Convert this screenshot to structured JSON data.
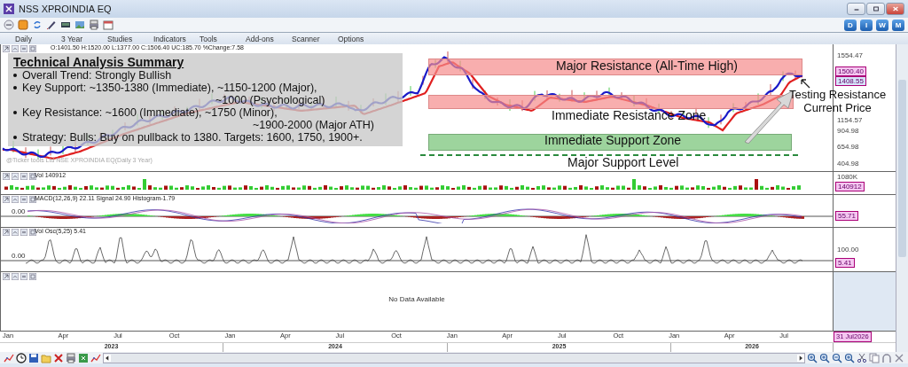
{
  "window": {
    "title": "NSS XPROINDIA EQ"
  },
  "period_buttons": [
    "D",
    "I",
    "W",
    "M"
  ],
  "menu": [
    "Daily",
    "3 Year",
    "Studies",
    "Indicators",
    "Tools",
    "Add-ons",
    "Scanner",
    "Options"
  ],
  "price_pane": {
    "ohlc": "O:1401.50  H:1520.00  L:1377.00  C:1506.40  UC:185.70  %Change:7.58",
    "watermark": "@Ticker tools Ltd NSE XPROINDIA EQ(Daily 3 Year)",
    "summary": {
      "title": "Technical Analysis Summary",
      "bullets": [
        {
          "text": "Overall Trend: Strongly Bullish"
        },
        {
          "text": "Key Support: ~1350-1380 (Immediate), ~1150-1200 (Major),",
          "continuation": "~1000 (Psychological)"
        },
        {
          "text": "Key Resistance:  ~1600 (Immediate), ~1750 (Minor),",
          "continuation": "~1900-2000 (Major ATH)"
        },
        {
          "text": "Strategy: Bulls: Buy on pullback to 1380. Targets: 1600, 1750, 1900+."
        }
      ]
    },
    "zones": [
      {
        "kind": "major_resistance",
        "label": "Major Resistance (All-Time High)"
      },
      {
        "kind": "immediate_resistance",
        "label": "Immediate Resistance Zone"
      },
      {
        "kind": "immediate_support",
        "label": "Immediate Support Zone"
      },
      {
        "kind": "major_support",
        "label": "Major Support Level"
      }
    ],
    "callout": [
      "Testing Resistance",
      "Current Price"
    ],
    "axis_ticks": [
      "1554.47",
      "1154.57",
      "904.98",
      "654.98",
      "404.98"
    ],
    "price_tags": [
      {
        "text": "1500.40",
        "color": "#f4c6f0"
      },
      {
        "text": "1408.55",
        "color": "#d6e4fa"
      }
    ]
  },
  "volume_pane": {
    "label": "Vol 140912",
    "axis_tick": "1080K",
    "value_tag": "140912"
  },
  "macd_pane": {
    "label": "MACD(12,26,9) 22.11 Signal 24.90 Histogram-1.79",
    "zero_label": "0.00",
    "value_tag": "55.71"
  },
  "oscillator_pane": {
    "label": "Vol Osc(5,25) 5.41",
    "zero_label": "0.00",
    "axis_tick": "100.00",
    "value_tag": "5.41"
  },
  "empty_pane": {
    "message": "No Data Available"
  },
  "time_axis": {
    "months": [
      "Jan",
      "Apr",
      "Jul",
      "Oct",
      "Jan",
      "Apr",
      "Jul",
      "Oct",
      "Jan",
      "Apr",
      "Jul",
      "Oct",
      "Jan",
      "Apr",
      "Jul"
    ],
    "years": [
      "2023",
      "2024",
      "2025",
      "2026"
    ],
    "date_tag": "31 Jul2026"
  }
}
